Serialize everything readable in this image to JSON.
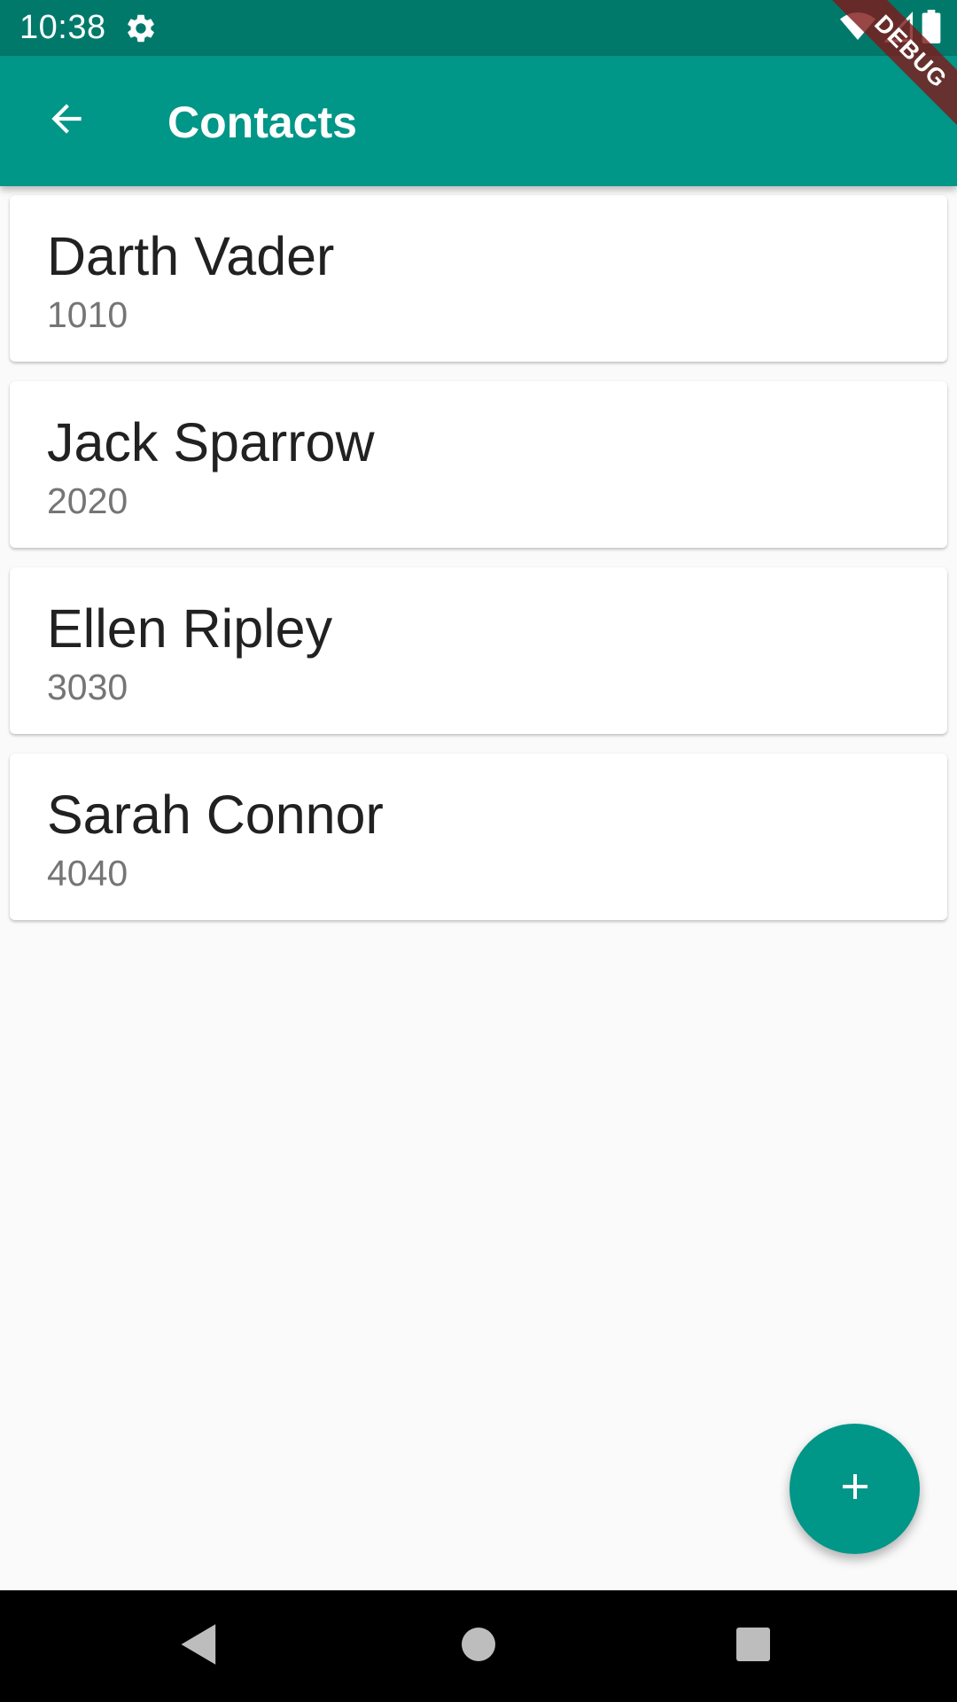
{
  "status_bar": {
    "time": "10:38",
    "icons": [
      "gear-icon",
      "wifi-icon",
      "cell-signal-icon",
      "battery-icon"
    ]
  },
  "debug_banner": "DEBUG",
  "app_bar": {
    "title": "Contacts",
    "back_icon": "arrow-back-icon"
  },
  "contacts": [
    {
      "name": "Darth Vader",
      "number": "1010"
    },
    {
      "name": "Jack Sparrow",
      "number": "2020"
    },
    {
      "name": "Ellen Ripley",
      "number": "3030"
    },
    {
      "name": "Sarah Connor",
      "number": "4040"
    }
  ],
  "fab": {
    "icon": "plus-icon"
  },
  "nav_bar": {
    "icons": [
      "nav-back-icon",
      "nav-home-icon",
      "nav-recents-icon"
    ]
  },
  "colors": {
    "primary": "#009688",
    "primary_dark": "#00796b",
    "background": "#fafafa",
    "card": "#ffffff",
    "name_text": "#212121",
    "number_text": "#757575",
    "debug_banner": "#801818"
  }
}
